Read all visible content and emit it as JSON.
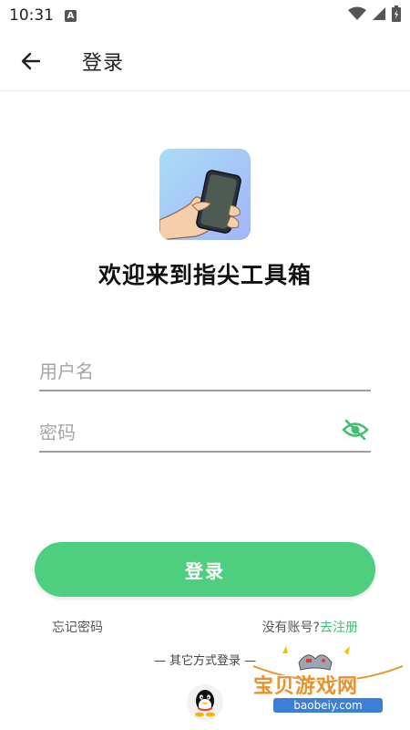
{
  "status_bar": {
    "time": "10:31",
    "notification_icon": "A"
  },
  "app_bar": {
    "title": "登录"
  },
  "welcome": {
    "title": "欢迎来到指尖工具箱"
  },
  "form": {
    "username_placeholder": "用户名",
    "password_placeholder": "密码",
    "login_label": "登录"
  },
  "links": {
    "forgot": "忘记密码",
    "no_account": "没有账号?",
    "register": "去注册"
  },
  "other_login": {
    "title": "— 其它方式登录 —"
  },
  "watermark": {
    "name": "宝贝游戏网",
    "domain": "baobeiy.com"
  },
  "colors": {
    "accent": "#4ecf7f",
    "register_link": "#3fbf6f",
    "eye_icon": "#3fbf6f"
  }
}
